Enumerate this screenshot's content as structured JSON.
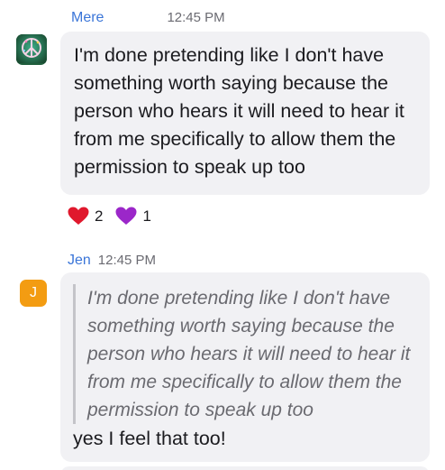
{
  "messages": [
    {
      "author": "Mere",
      "time": "12:45 PM",
      "avatar_icon": "peace-sign-icon",
      "avatar_color": "#1f5e3c",
      "text": "I'm done pretending like I don't have something worth saying because the person who hears it will need to hear it from me specifically to allow them the permission to speak up too",
      "reactions": [
        {
          "icon": "red-heart-icon",
          "color": "#e0182d",
          "count": "2"
        },
        {
          "icon": "purple-heart-icon",
          "color": "#9b27c9",
          "count": "1"
        }
      ]
    },
    {
      "author": "Jen",
      "time": "12:45 PM",
      "avatar_initial": "J",
      "avatar_color": "#f39c12",
      "quote": "I'm done pretending like I don't have something worth saying because the person who hears it will need to hear it from me specifically to allow them the permission to speak up too",
      "text": "yes I feel that too!"
    }
  ],
  "colors": {
    "author_name": "#3a75d8",
    "bubble_bg": "#f1f1f4",
    "timestamp": "#6b6b72"
  }
}
